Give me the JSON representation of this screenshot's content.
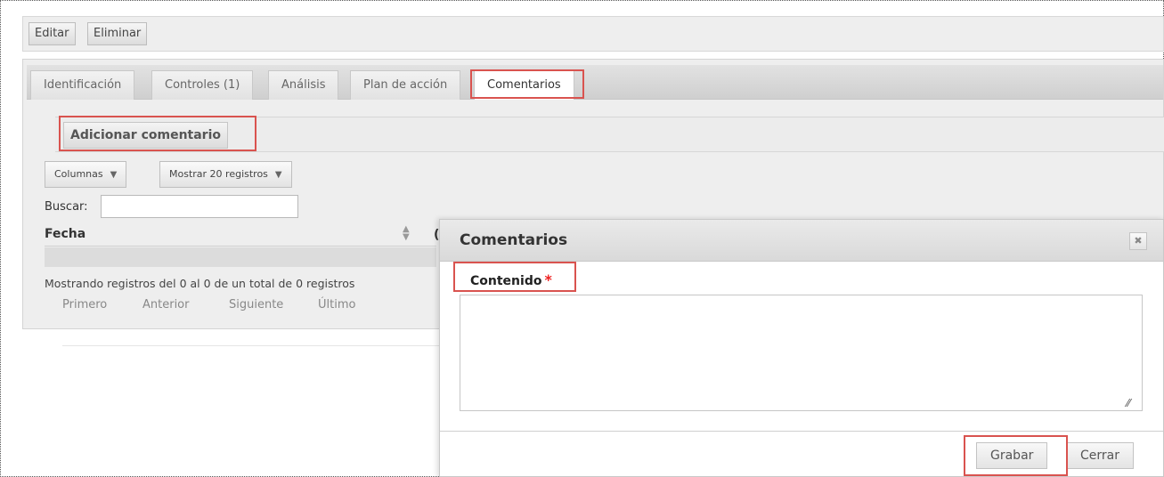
{
  "toolbar": {
    "edit_label": "Editar",
    "delete_label": "Eliminar"
  },
  "tabs": [
    {
      "label": "Identificación"
    },
    {
      "label": "Controles (1)"
    },
    {
      "label": "Análisis"
    },
    {
      "label": "Plan de acción"
    },
    {
      "label": "Comentarios",
      "active": true
    }
  ],
  "comments": {
    "add_label": "Adicionar comentario",
    "columns_label": "Columnas",
    "page_size_label": "Mostrar 20 registros",
    "search_label": "Buscar:",
    "search_value": "",
    "table": {
      "headers": [
        "Fecha"
      ],
      "rows": []
    },
    "info": "Mostrando registros del 0 al 0 de un total de 0 registros",
    "pager": {
      "first": "Primero",
      "prev": "Anterior",
      "next": "Siguiente",
      "last": "Último"
    }
  },
  "modal": {
    "title": "Comentarios",
    "content_label": "Contenido",
    "required_mark": "*",
    "content_value": "",
    "save_label": "Grabar",
    "close_label": "Cerrar"
  },
  "colors": {
    "highlight": "#d9534f",
    "required": "#ee2222",
    "panel_bg": "#eeeeee"
  }
}
